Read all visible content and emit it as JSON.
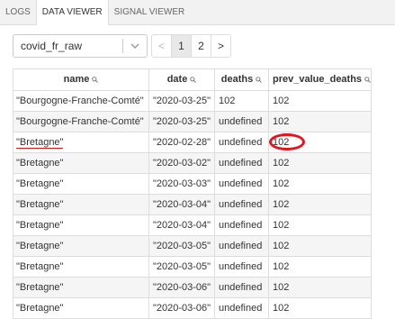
{
  "tabs": [
    {
      "label": "LOGS",
      "active": false
    },
    {
      "label": "DATA VIEWER",
      "active": true
    },
    {
      "label": "SIGNAL VIEWER",
      "active": false
    }
  ],
  "dataset_select": {
    "value": "covid_fr_raw"
  },
  "pagination": {
    "prev": "<",
    "pages": [
      "1",
      "2"
    ],
    "current": "1",
    "next": ">"
  },
  "table": {
    "columns": [
      "name",
      "date",
      "deaths",
      "prev_value_deaths"
    ],
    "rows": [
      [
        "\"Bourgogne-Franche-Comté\"",
        "\"2020-03-25\"",
        "102",
        "102"
      ],
      [
        "\"Bourgogne-Franche-Comté\"",
        "\"2020-03-25\"",
        "undefined",
        "102"
      ],
      [
        "\"Bretagne\"",
        "\"2020-02-28\"",
        "undefined",
        "102"
      ],
      [
        "\"Bretagne\"",
        "\"2020-03-02\"",
        "undefined",
        "102"
      ],
      [
        "\"Bretagne\"",
        "\"2020-03-03\"",
        "undefined",
        "102"
      ],
      [
        "\"Bretagne\"",
        "\"2020-03-04\"",
        "undefined",
        "102"
      ],
      [
        "\"Bretagne\"",
        "\"2020-03-04\"",
        "undefined",
        "102"
      ],
      [
        "\"Bretagne\"",
        "\"2020-03-05\"",
        "undefined",
        "102"
      ],
      [
        "\"Bretagne\"",
        "\"2020-03-05\"",
        "undefined",
        "102"
      ],
      [
        "\"Bretagne\"",
        "\"2020-03-06\"",
        "undefined",
        "102"
      ],
      [
        "\"Bretagne\"",
        "\"2020-03-06\"",
        "undefined",
        "102"
      ]
    ]
  },
  "annotations": {
    "underline_color": "#d01919",
    "circle_color": "#e3141c"
  }
}
